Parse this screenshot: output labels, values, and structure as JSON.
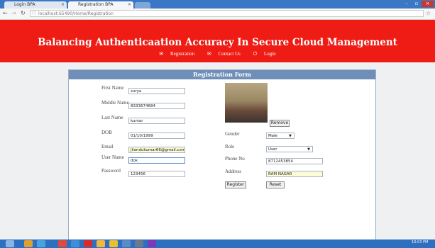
{
  "browser": {
    "tabs": [
      {
        "label": "Login BPA"
      },
      {
        "label": "Registration BPA"
      }
    ],
    "url": "localhost:65490/Home/Registration"
  },
  "site": {
    "title": "Balancing Authenticaation Accuracy In Secure Cloud Management",
    "nav": [
      "Registration",
      "Contact Us",
      "Login"
    ]
  },
  "form": {
    "heading": "Registration Form",
    "first_name": {
      "label": "First Name",
      "value": "surya"
    },
    "middle_name": {
      "label": "Middle Name",
      "value": "8333674684"
    },
    "last_name": {
      "label": "Last Name",
      "value": "kumar"
    },
    "dob": {
      "label": "DOB",
      "value": "01/10/1999"
    },
    "email": {
      "label": "Email",
      "value": "jilandukumar66@gmail.com"
    },
    "user_name": {
      "label": "User Name",
      "value": "dok"
    },
    "password": {
      "label": "Password",
      "value": "123456"
    },
    "gender": {
      "label": "Gender",
      "value": "Male"
    },
    "role": {
      "label": "Role",
      "value": "User"
    },
    "phone": {
      "label": "Phone No",
      "value": "8712453854"
    },
    "address": {
      "label": "Address",
      "value": "RAM NAGAR"
    },
    "remove_label": "Remove",
    "register_label": "Register",
    "reset_label": "Reset"
  },
  "taskbar": {
    "time": "10:03 PM"
  },
  "colors": {
    "banner": "#ee1c14",
    "panel_head": "#6f8fb8",
    "taskbar": "#2f6fc0"
  }
}
